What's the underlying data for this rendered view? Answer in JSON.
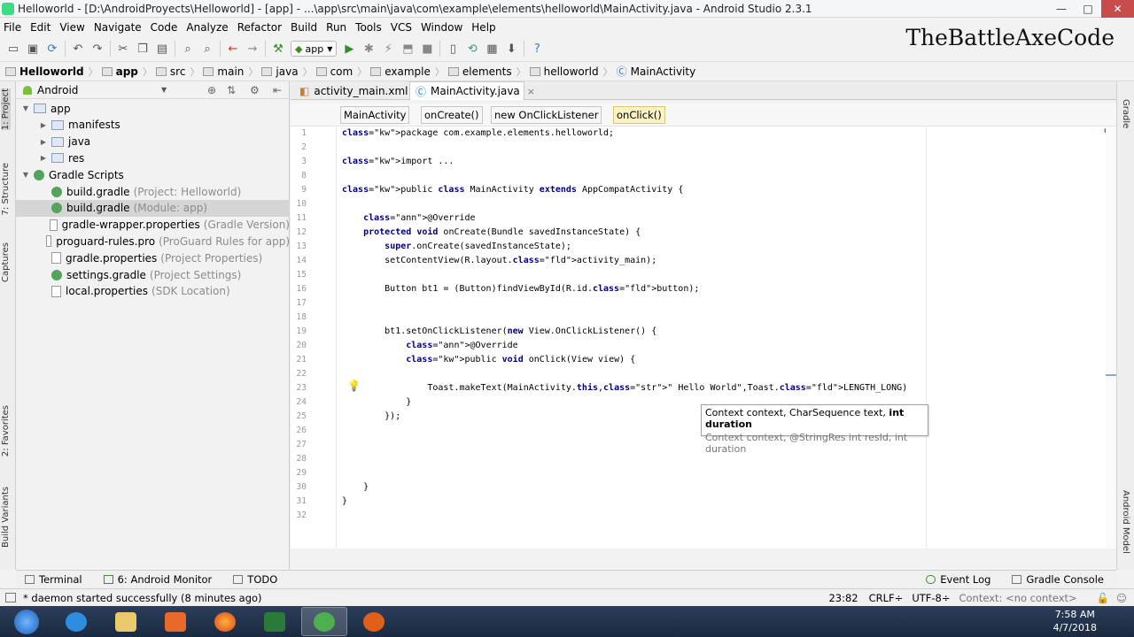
{
  "window": {
    "title": "Helloworld - [D:\\AndroidProyects\\Helloworld] - [app] - ...\\app\\src\\main\\java\\com\\example\\elements\\helloworld\\MainActivity.java - Android Studio 2.3.1",
    "minimize": "—",
    "maximize": "□",
    "close": "✕"
  },
  "menu": [
    "File",
    "Edit",
    "View",
    "Navigate",
    "Code",
    "Analyze",
    "Refactor",
    "Build",
    "Run",
    "Tools",
    "VCS",
    "Window",
    "Help"
  ],
  "toolbar": {
    "run_config": "app"
  },
  "watermark": "TheBattleAxeCode",
  "breadcrumbs": [
    "Helloworld",
    "app",
    "src",
    "main",
    "java",
    "com",
    "example",
    "elements",
    "helloworld",
    "MainActivity"
  ],
  "left_strip": [
    "1: Project",
    "7: Structure",
    "Captures",
    "2: Favorites",
    "Build Variants"
  ],
  "right_strip": [
    "Gradle",
    "Android Model"
  ],
  "project_panel": {
    "view": "Android",
    "items": [
      {
        "label": "app",
        "hint": "",
        "level": 0,
        "icon": "folder-icon",
        "twisty": "▼"
      },
      {
        "label": "manifests",
        "hint": "",
        "level": 1,
        "icon": "folder-icon",
        "twisty": "▶"
      },
      {
        "label": "java",
        "hint": "",
        "level": 1,
        "icon": "folder-icon",
        "twisty": "▶"
      },
      {
        "label": "res",
        "hint": "",
        "level": 1,
        "icon": "folder-icon",
        "twisty": "▶"
      },
      {
        "label": "Gradle Scripts",
        "hint": "",
        "level": 0,
        "icon": "gradle-icon",
        "twisty": "▼"
      },
      {
        "label": "build.gradle",
        "hint": "(Project: Helloworld)",
        "level": 1,
        "icon": "gradle-icon",
        "twisty": ""
      },
      {
        "label": "build.gradle",
        "hint": "(Module: app)",
        "level": 1,
        "icon": "gradle-icon",
        "twisty": "",
        "selected": true
      },
      {
        "label": "gradle-wrapper.properties",
        "hint": "(Gradle Version)",
        "level": 1,
        "icon": "properties-icon",
        "twisty": ""
      },
      {
        "label": "proguard-rules.pro",
        "hint": "(ProGuard Rules for app)",
        "level": 1,
        "icon": "properties-icon",
        "twisty": ""
      },
      {
        "label": "gradle.properties",
        "hint": "(Project Properties)",
        "level": 1,
        "icon": "properties-icon",
        "twisty": ""
      },
      {
        "label": "settings.gradle",
        "hint": "(Project Settings)",
        "level": 1,
        "icon": "gradle-icon",
        "twisty": ""
      },
      {
        "label": "local.properties",
        "hint": "(SDK Location)",
        "level": 1,
        "icon": "properties-icon",
        "twisty": ""
      }
    ]
  },
  "editor_tabs": [
    {
      "label": "activity_main.xml",
      "close": "×"
    },
    {
      "label": "MainActivity.java",
      "close": "×",
      "active": true
    }
  ],
  "editor_breadcrumb": [
    "MainActivity",
    "onCreate()",
    "new OnClickListener",
    "onClick()"
  ],
  "code_lines": [
    {
      "n": "1",
      "text": "package com.example.elements.helloworld;"
    },
    {
      "n": "2",
      "text": ""
    },
    {
      "n": "3",
      "text": "import ..."
    },
    {
      "n": "8",
      "text": ""
    },
    {
      "n": "9",
      "text": "public class MainActivity extends AppCompatActivity {"
    },
    {
      "n": "10",
      "text": ""
    },
    {
      "n": "11",
      "text": "    @Override"
    },
    {
      "n": "12",
      "text": "    protected void onCreate(Bundle savedInstanceState) {"
    },
    {
      "n": "13",
      "text": "        super.onCreate(savedInstanceState);"
    },
    {
      "n": "14",
      "text": "        setContentView(R.layout.activity_main);"
    },
    {
      "n": "15",
      "text": ""
    },
    {
      "n": "16",
      "text": "        Button bt1 = (Button)findViewById(R.id.button);"
    },
    {
      "n": "17",
      "text": ""
    },
    {
      "n": "18",
      "text": ""
    },
    {
      "n": "19",
      "text": "        bt1.setOnClickListener(new View.OnClickListener() {"
    },
    {
      "n": "20",
      "text": "            @Override"
    },
    {
      "n": "21",
      "text": "            public void onClick(View view) {"
    },
    {
      "n": "22",
      "text": ""
    },
    {
      "n": "23",
      "text": "                Toast.makeText(MainActivity.this,\" Hello World\",Toast.LENGTH_LONG)"
    },
    {
      "n": "24",
      "text": "            }"
    },
    {
      "n": "25",
      "text": "        });"
    },
    {
      "n": "26",
      "text": ""
    },
    {
      "n": "27",
      "text": ""
    },
    {
      "n": "28",
      "text": ""
    },
    {
      "n": "29",
      "text": ""
    },
    {
      "n": "30",
      "text": "    }"
    },
    {
      "n": "31",
      "text": "}"
    },
    {
      "n": "32",
      "text": ""
    }
  ],
  "param_hint": {
    "line1_plain": "Context context, CharSequence text, ",
    "line1_bold": "int duration",
    "line2": "Context context, @StringRes int resId, int duration"
  },
  "bottom_tabs": {
    "terminal": "Terminal",
    "android_monitor": "6: Android Monitor",
    "todo": "TODO",
    "event_log": "Event Log",
    "gradle_console": "Gradle Console"
  },
  "status": {
    "message": "* daemon started successfully (8 minutes ago)",
    "position": "23:82",
    "line_sep": "CRLF÷",
    "encoding": "UTF-8÷",
    "context": "Context: <no context>"
  },
  "clock": {
    "time": "7:58 AM",
    "date": "4/7/2018"
  }
}
